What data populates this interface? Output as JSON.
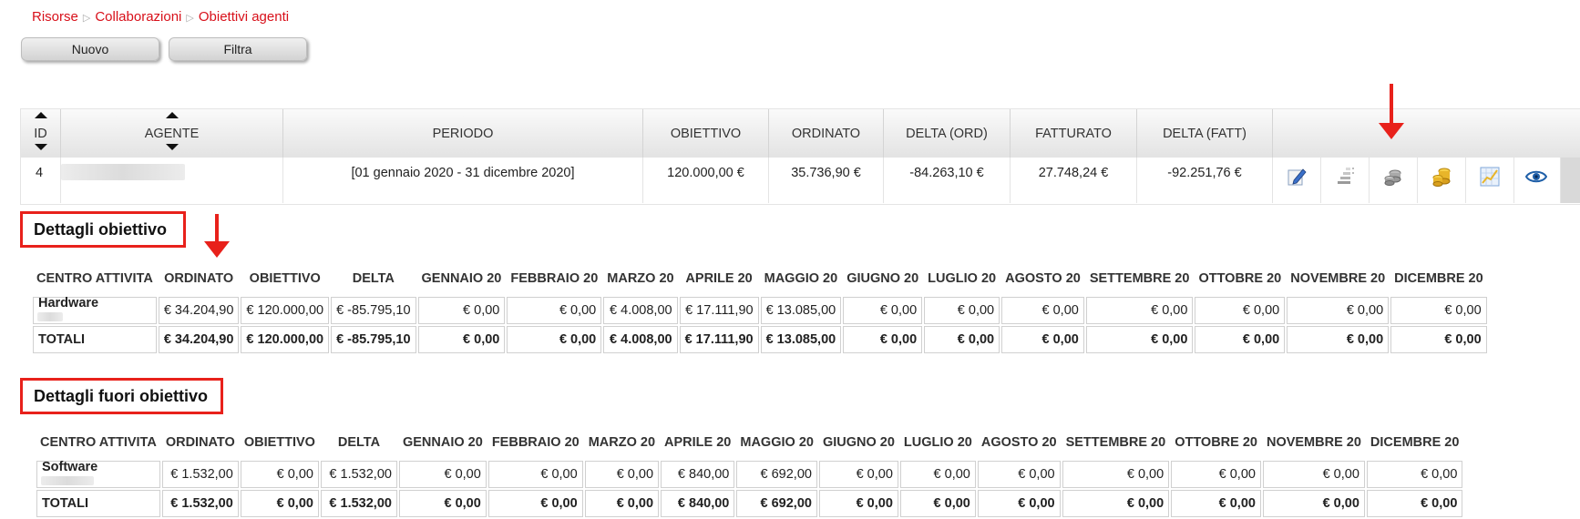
{
  "breadcrumb": [
    "Risorse",
    "Collaborazioni",
    "Obiettivi agenti"
  ],
  "breadcrumb_sep": "▷",
  "toolbar": {
    "new_label": "Nuovo",
    "filter_label": "Filtra"
  },
  "grid": {
    "headers": [
      "ID",
      "AGENTE",
      "PERIODO",
      "OBIETTIVO",
      "ORDINATO",
      "DELTA (ORD)",
      "FATTURATO",
      "DELTA (FATT)"
    ],
    "row": {
      "id": "4",
      "periodo": "[01 gennaio 2020 - 31 dicembre 2020]",
      "obiettivo": "120.000,00 €",
      "ordinato": "35.736,90 €",
      "delta_ord": "-84.263,10 €",
      "fatturato": "27.748,24 €",
      "delta_fatt": "-92.251,76 €"
    },
    "row_actions": [
      "edit-icon",
      "list-icon",
      "coins-grey-icon",
      "coins-gold-icon",
      "chart-icon",
      "eye-icon"
    ]
  },
  "accent_color": "#e8211b",
  "link_color": "#d8101a",
  "dettagli": {
    "title": "Dettagli obiettivo",
    "headers": [
      "CENTRO ATTIVITA",
      "ORDINATO",
      "OBIETTIVO",
      "DELTA",
      "GENNAIO 20",
      "FEBBRAIO 20",
      "MARZO 20",
      "APRILE 20",
      "MAGGIO 20",
      "GIUGNO 20",
      "LUGLIO 20",
      "AGOSTO 20",
      "SETTEMBRE 20",
      "OTTOBRE 20",
      "NOVEMBRE 20",
      "DICEMBRE 20"
    ],
    "rows": [
      [
        "Hardware",
        "€ 34.204,90",
        "€ 120.000,00",
        "€ -85.795,10",
        "€ 0,00",
        "€ 0,00",
        "€ 4.008,00",
        "€ 17.111,90",
        "€ 13.085,00",
        "€ 0,00",
        "€ 0,00",
        "€ 0,00",
        "€ 0,00",
        "€ 0,00",
        "€ 0,00",
        "€ 0,00"
      ]
    ],
    "totals": [
      "TOTALI",
      "€ 34.204,90",
      "€ 120.000,00",
      "€ -85.795,10",
      "€ 0,00",
      "€ 0,00",
      "€ 4.008,00",
      "€ 17.111,90",
      "€ 13.085,00",
      "€ 0,00",
      "€ 0,00",
      "€ 0,00",
      "€ 0,00",
      "€ 0,00",
      "€ 0,00",
      "€ 0,00"
    ]
  },
  "fuori": {
    "title": "Dettagli fuori obiettivo",
    "headers": [
      "CENTRO ATTIVITA",
      "ORDINATO",
      "OBIETTIVO",
      "DELTA",
      "GENNAIO 20",
      "FEBBRAIO 20",
      "MARZO 20",
      "APRILE 20",
      "MAGGIO 20",
      "GIUGNO 20",
      "LUGLIO 20",
      "AGOSTO 20",
      "SETTEMBRE 20",
      "OTTOBRE 20",
      "NOVEMBRE 20",
      "DICEMBRE 20"
    ],
    "rows": [
      [
        "Software",
        "€ 1.532,00",
        "€ 0,00",
        "€ 1.532,00",
        "€ 0,00",
        "€ 0,00",
        "€ 0,00",
        "€ 840,00",
        "€ 692,00",
        "€ 0,00",
        "€ 0,00",
        "€ 0,00",
        "€ 0,00",
        "€ 0,00",
        "€ 0,00",
        "€ 0,00"
      ]
    ],
    "totals": [
      "TOTALI",
      "€ 1.532,00",
      "€ 0,00",
      "€ 1.532,00",
      "€ 0,00",
      "€ 0,00",
      "€ 0,00",
      "€ 840,00",
      "€ 692,00",
      "€ 0,00",
      "€ 0,00",
      "€ 0,00",
      "€ 0,00",
      "€ 0,00",
      "€ 0,00",
      "€ 0,00"
    ]
  }
}
